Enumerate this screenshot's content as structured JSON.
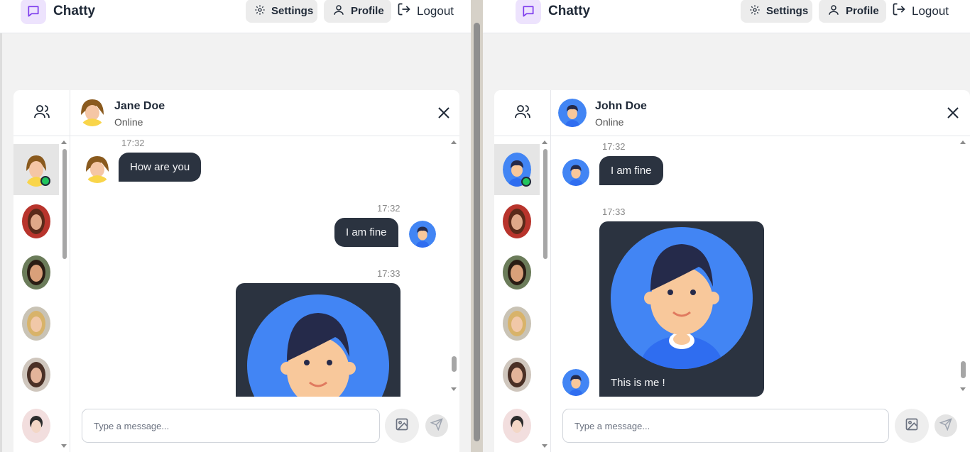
{
  "left": {
    "navbar": {
      "brand": "Chatty",
      "settings": "Settings",
      "profile": "Profile",
      "logout": "Logout"
    },
    "chat": {
      "name": "Jane Doe",
      "status": "Online",
      "messages": [
        {
          "time": "17:32",
          "text": "How are you",
          "direction": "in"
        },
        {
          "time": "17:32",
          "text": "I am fine",
          "direction": "out"
        },
        {
          "time": "17:33",
          "text": "",
          "direction": "out",
          "type": "image"
        }
      ]
    },
    "input": {
      "placeholder": "Type a message..."
    }
  },
  "right": {
    "navbar": {
      "brand": "Chatty",
      "settings": "Settings",
      "profile": "Profile",
      "logout": "Logout"
    },
    "chat": {
      "name": "John Doe",
      "status": "Online",
      "messages": [
        {
          "time": "17:32",
          "text": "I am fine",
          "direction": "in"
        },
        {
          "time": "17:33",
          "text": "This is me !",
          "direction": "in",
          "type": "image"
        }
      ]
    },
    "input": {
      "placeholder": "Type a message..."
    }
  },
  "icons": {
    "logo": "message-square-icon",
    "settings": "gear-icon",
    "profile": "user-icon",
    "logout": "log-out-icon",
    "contacts": "users-icon",
    "close": "close-icon",
    "image": "image-icon",
    "send": "send-icon"
  },
  "colors": {
    "accent": "#7c3aed",
    "bubble": "#2b3340",
    "online": "#22c55e",
    "avatar_blue": "#4285f4"
  }
}
